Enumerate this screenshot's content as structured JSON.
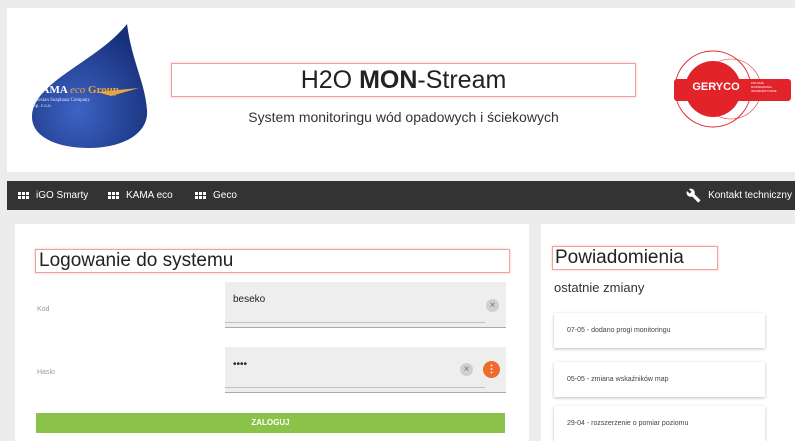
{
  "header": {
    "logo_left": {
      "brand_main": "KAMA",
      "brand_eco": "eco",
      "brand_group": "Group",
      "brand_sub_line1": "Silesian Soapbaza Company",
      "brand_sub_line2": "Sp. z o.o."
    },
    "title_normal_1": "H2O ",
    "title_bold": "MON",
    "title_normal_2": "-Stream",
    "subtitle": "System monitoringu wód opadowych i ściekowych",
    "logo_right": {
      "name": "GERYCO",
      "small_line1": "POLSKIE",
      "small_line2": "ROZWIĄZANIA",
      "small_line3": "INFORMATYCZNE"
    }
  },
  "nav": {
    "items": [
      {
        "label": "iGO Smarty",
        "icon": "grid-icon"
      },
      {
        "label": "KAMA eco",
        "icon": "grid-icon"
      },
      {
        "label": "Geco",
        "icon": "grid-icon"
      }
    ],
    "contact": {
      "label": "Kontakt techniczny",
      "icon": "wrench-icon"
    }
  },
  "login": {
    "title": "Logowanie do systemu",
    "code_label": "Kod",
    "code_value": "beseko",
    "password_label": "Haslo",
    "password_value": "••••",
    "submit_label": "ZALOGUJ"
  },
  "notifications": {
    "title": "Powiadomienia",
    "subtitle": "ostatnie zmiany",
    "items": [
      "07-05 - dodano progi monitoringu",
      "05-05 - zmiana wskaźników map",
      "29-04 - rozszerzenie o pomiar poziomu"
    ]
  },
  "colors": {
    "navbar": "#333333",
    "accent_green": "#8bc34a",
    "accent_orange": "#f06a2c",
    "title_border": "#f0a0a0",
    "geryco_red": "#e2232a",
    "drop_blue": "#1f3f8f"
  }
}
